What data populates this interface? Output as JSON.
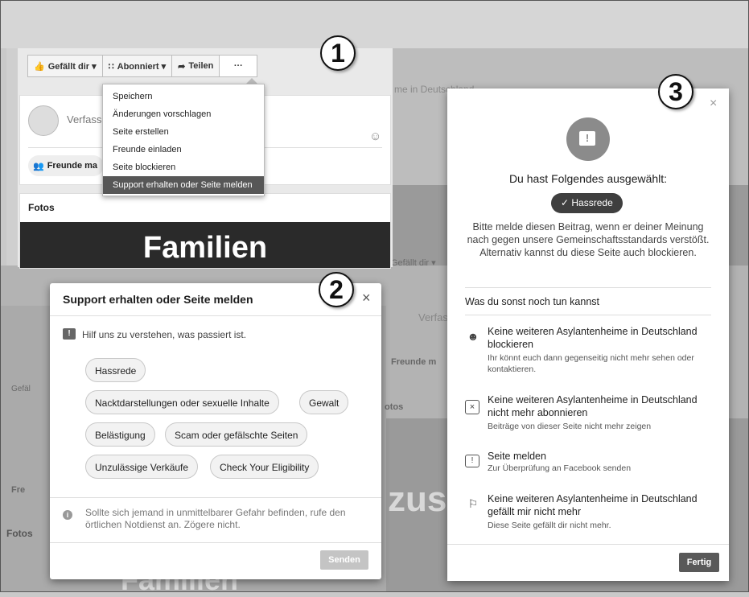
{
  "background": {
    "ghost_top_right": "me in Deutschland",
    "ghost_gefaellt_dir_mid": "Gefällt dir ▾",
    "ghost_gefaellt_dir_left": "Gefäl",
    "ghost_verfass": "Verfas",
    "ghost_freunde": "Freunde m",
    "ghost_fotos": "otos",
    "ghost_fotos_left": "Fotos",
    "ghost_fre": "Fre",
    "ghost_zus": "zus",
    "ghost_familien": "Familien"
  },
  "panel1": {
    "toolbar": {
      "like_label": "Gefällt dir ▾",
      "follow_label": "Abonniert ▾",
      "share_label": "Teilen",
      "more_label": "···"
    },
    "composer_placeholder": "Verfasse",
    "invite_label": "Freunde ma",
    "fotos_heading": "Fotos",
    "familien_text": "Familien",
    "menu": [
      "Speichern",
      "Änderungen vorschlagen",
      "Seite erstellen",
      "Freunde einladen",
      "Seite blockieren",
      "Support erhalten oder Seite melden"
    ],
    "badge": "1"
  },
  "dialog2": {
    "badge": "2",
    "title": "Support erhalten oder Seite melden",
    "close": "×",
    "prompt": "Hilf uns zu verstehen, was passiert ist.",
    "chips": [
      "Hassrede",
      "Nacktdarstellungen oder sexuelle Inhalte",
      "Gewalt",
      "Belästigung",
      "Scam oder gefälschte Seiten",
      "Unzulässige Verkäufe",
      "Check Your Eligibility"
    ],
    "emergency_note": "Sollte sich jemand in unmittelbarer Gefahr befinden, rufe den örtlichen Notdienst an. Zögere nicht.",
    "send_button": "Senden"
  },
  "dialog3": {
    "badge": "3",
    "close": "×",
    "heading": "Du hast Folgendes ausgewählt:",
    "selected": "✓ Hassrede",
    "description": "Bitte melde diesen Beitrag, wenn er deiner Meinung nach gegen unsere Gemeinschaftsstandards verstößt. Alternativ kannst du diese Seite auch blockieren.",
    "section_title": "Was du sonst noch tun kannst",
    "options": [
      {
        "title": "Keine weiteren Asylantenheime in Deutschland blockieren",
        "subtitle": "Ihr könnt euch dann gegenseitig nicht mehr sehen oder kontaktieren.",
        "icon": "block-user-icon"
      },
      {
        "title": "Keine weiteren Asylantenheime in Deutschland nicht mehr abonnieren",
        "subtitle": "Beiträge von dieser Seite nicht mehr zeigen",
        "icon": "unfollow-icon"
      },
      {
        "title": "Seite melden",
        "subtitle": "Zur Überprüfung an Facebook senden",
        "icon": "report-icon"
      },
      {
        "title": "Keine weiteren Asylantenheime in Deutschland gefällt mir nicht mehr",
        "subtitle": "Diese Seite gefällt dir nicht mehr.",
        "icon": "unlike-flag-icon"
      }
    ],
    "done_button": "Fertig"
  }
}
